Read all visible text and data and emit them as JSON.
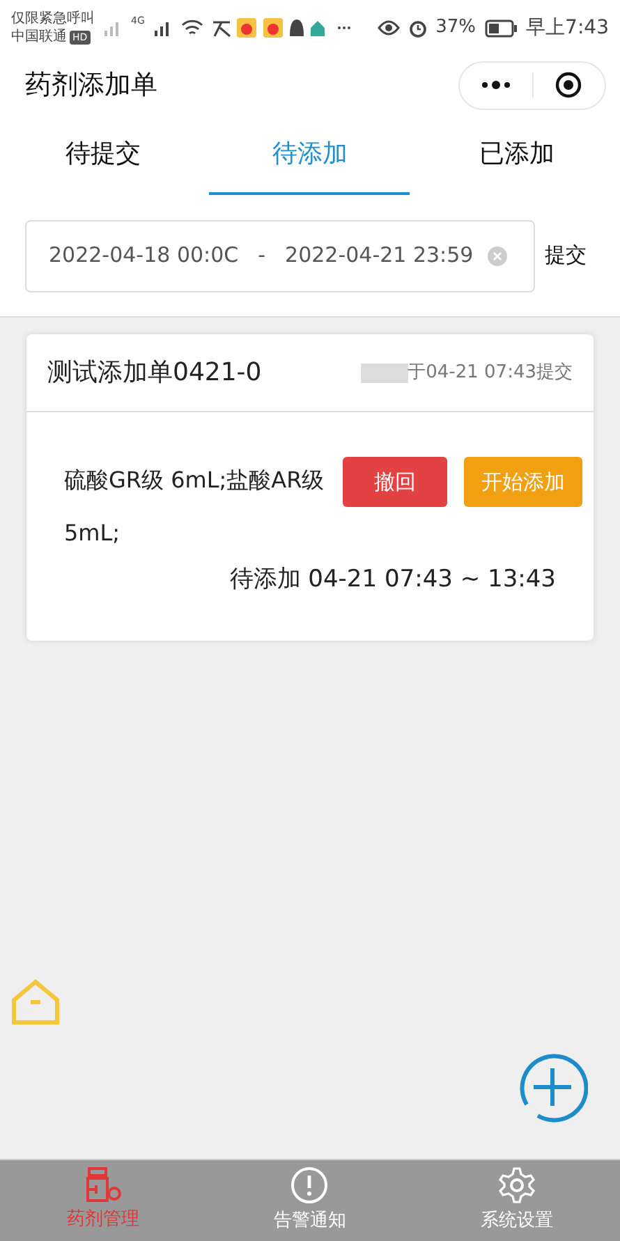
{
  "status_bar": {
    "carrier_note": "仅限紧急呼叫",
    "carrier": "中国联通",
    "hd": "HD",
    "network": "4G",
    "battery": "37%",
    "time": "早上7:43"
  },
  "header": {
    "title": "药剂添加单"
  },
  "tabs": [
    {
      "label": "待提交",
      "selected": false
    },
    {
      "label": "待添加",
      "selected": true
    },
    {
      "label": "已添加",
      "selected": false
    }
  ],
  "date_filter": {
    "start": "2022-04-18 00:0C",
    "separator": "-",
    "end": "2022-04-21 23:59",
    "submit": "提交"
  },
  "cards": [
    {
      "title": "测试添加单0421-0",
      "submitted": "于04-21 07:43提交",
      "content": "硫酸GR级 6mL;盐酸AR级 5mL;",
      "buttons": [
        "撤回",
        "开始添加"
      ],
      "status": "待添加 04-21 07:43 ~ 13:43"
    }
  ],
  "nav": [
    {
      "label": "药剂管理",
      "kind": "medicine",
      "selected": true
    },
    {
      "label": "告警通知",
      "kind": "alert",
      "selected": false
    },
    {
      "label": "系统设置",
      "kind": "settings",
      "selected": false
    }
  ]
}
